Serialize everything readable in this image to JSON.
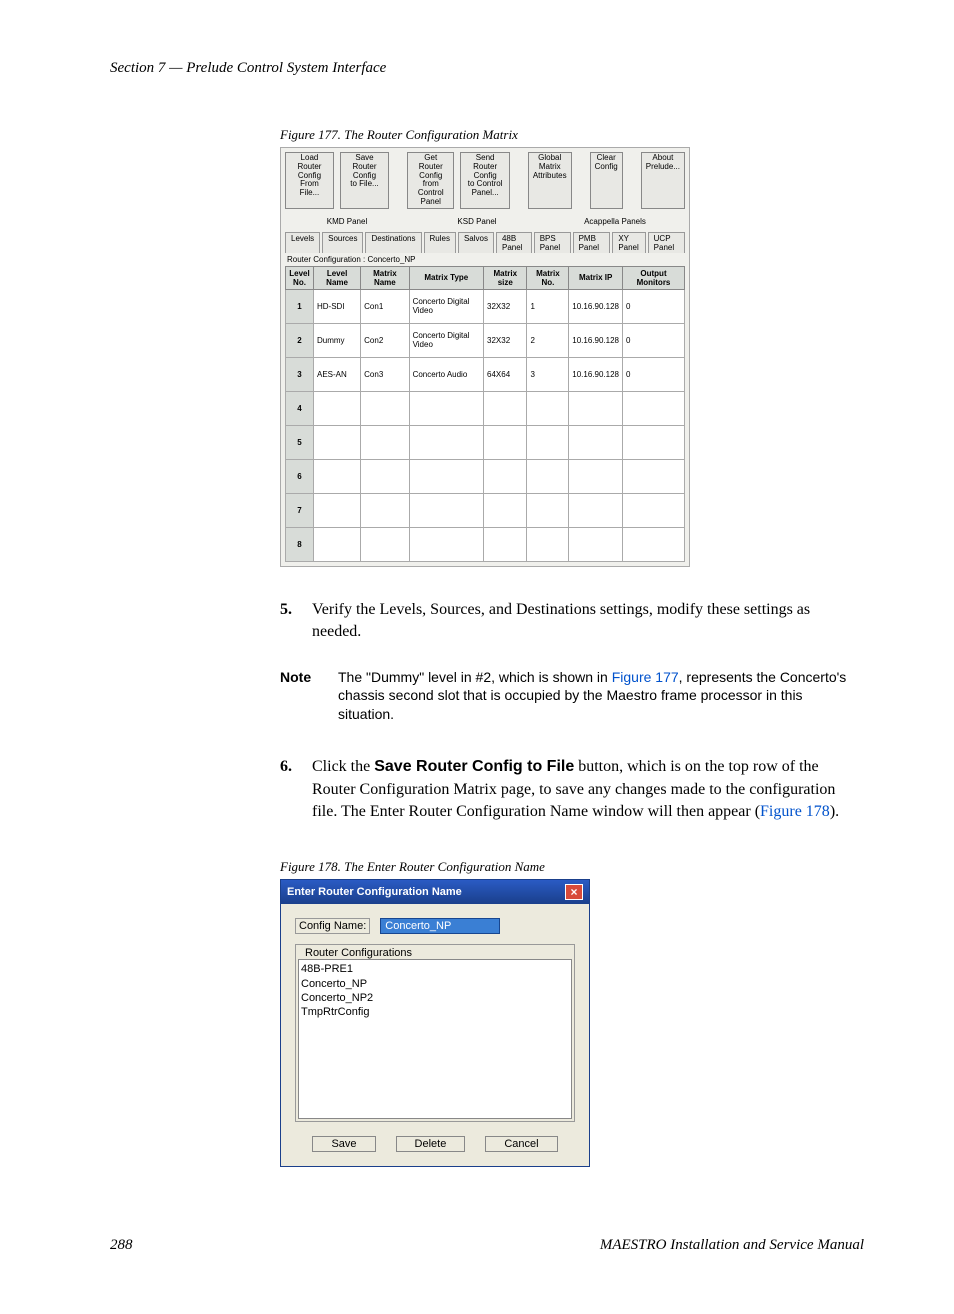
{
  "header": {
    "section": "Section 7 — Prelude Control System Interface"
  },
  "fig177": {
    "caption": "Figure 177.  The Router Configuration Matrix",
    "buttons": {
      "load": "Load Router Config\nFrom File...",
      "save": "Save Router Config\nto File...",
      "get": "Get Router Config\nfrom Control Panel",
      "send": "Send Router Config\nto Control Panel...",
      "global": "Global Matrix\nAttributes",
      "clear": "Clear\nConfig",
      "about": "About\nPrelude..."
    },
    "tab_labels": {
      "kmd": "KMD Panel",
      "ksd": "KSD Panel",
      "aca": "Acappella Panels"
    },
    "tabs": [
      "Levels",
      "Sources",
      "Destinations",
      "Rules",
      "Salvos",
      "48B Panel",
      "BPS Panel",
      "PMB Panel",
      "XY Panel",
      "UCP Panel"
    ],
    "config_line": "Router Configuration : Concerto_NP",
    "cols": [
      "Level\nNo.",
      "Level Name",
      "Matrix Name",
      "Matrix Type",
      "Matrix size",
      "Matrix\nNo.",
      "Matrix IP",
      "Output\nMonitors"
    ],
    "rows": [
      {
        "no": "1",
        "name": "HD-SDI",
        "mname": "Con1",
        "type": "Concerto Digital Video",
        "size": "32X32",
        "mno": "1",
        "ip": "10.16.90.128",
        "om": "0"
      },
      {
        "no": "2",
        "name": "Dummy",
        "mname": "Con2",
        "type": "Concerto Digital Video",
        "size": "32X32",
        "mno": "2",
        "ip": "10.16.90.128",
        "om": "0"
      },
      {
        "no": "3",
        "name": "AES-AN",
        "mname": "Con3",
        "type": "Concerto Audio",
        "size": "64X64",
        "mno": "3",
        "ip": "10.16.90.128",
        "om": "0"
      },
      {
        "no": "4"
      },
      {
        "no": "5"
      },
      {
        "no": "6"
      },
      {
        "no": "7"
      },
      {
        "no": "8"
      }
    ]
  },
  "steps": {
    "s5": {
      "num": "5.",
      "text": "Verify the Levels, Sources, and Destinations settings, modify these settings as needed."
    },
    "note": {
      "label": "Note",
      "pre": "The \"Dummy\" level in #2, which is shown in ",
      "link": "Figure 177",
      "post": ", represents the Concerto's chassis second slot that is occupied by the Maestro frame processor in this situation."
    },
    "s6": {
      "num": "6.",
      "pre": "Click the ",
      "bold": "Save Router Config to File",
      "mid": " button, which is on the top row of the Router Configuration Matrix page, to save any changes made to the configuration file. The Enter Router Configuration Name window will then appear (",
      "link": "Figure 178",
      "post": ")."
    }
  },
  "fig178": {
    "caption": "Figure 178.  The Enter Router Configuration Name",
    "title": "Enter Router Configuration Name",
    "config_label": "Config Name:",
    "config_value": "Concerto_NP",
    "fieldset": "Router Configurations",
    "list": [
      "48B-PRE1",
      "Concerto_NP",
      "Concerto_NP2",
      "TmpRtrConfig"
    ],
    "buttons": {
      "save": "Save",
      "delete": "Delete",
      "cancel": "Cancel"
    }
  },
  "footer": {
    "page": "288",
    "manual": "MAESTRO Installation and Service Manual"
  }
}
